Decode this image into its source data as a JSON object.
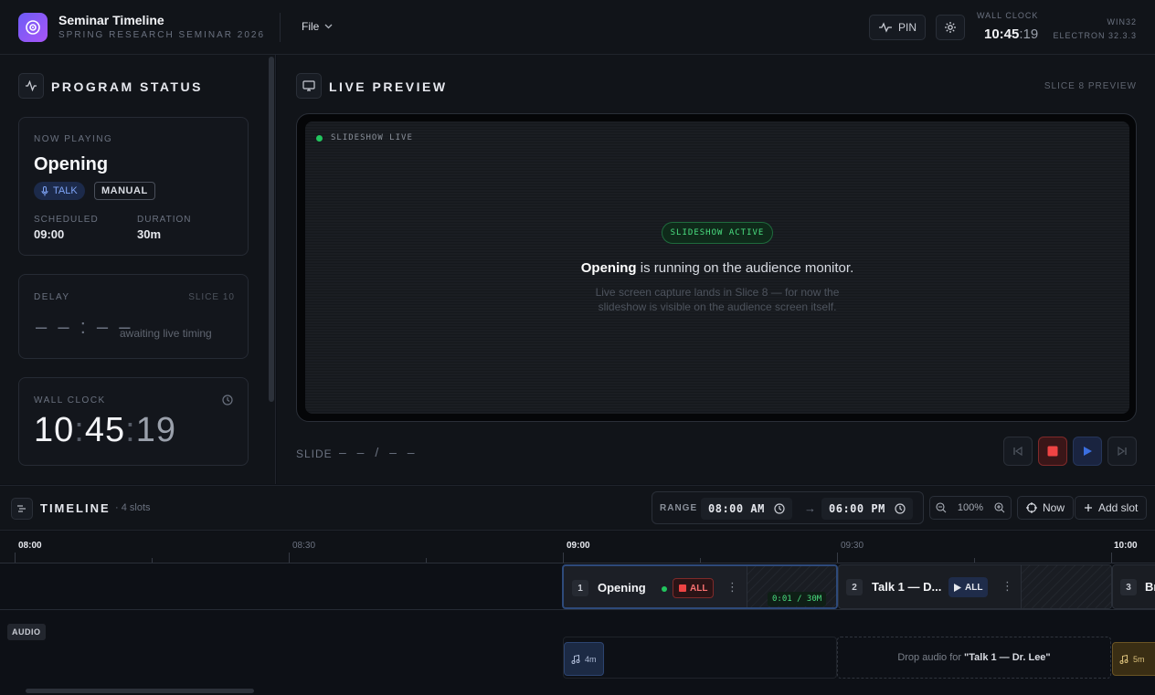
{
  "header": {
    "app_title": "Seminar Timeline",
    "app_subtitle": "SPRING RESEARCH SEMINAR 2026",
    "file_menu": "File",
    "pin_label": "PIN",
    "wall_clock_label": "WALL CLOCK",
    "wall_clock_hm": "10:45",
    "wall_clock_sec": ":19",
    "platform": "WIN32",
    "electron": "ELECTRON 32.3.3"
  },
  "program_status": {
    "title": "PROGRAM STATUS",
    "now_playing": {
      "label": "NOW PLAYING",
      "title": "Opening",
      "type_tag": "TALK",
      "mode_tag": "MANUAL",
      "scheduled_label": "SCHEDULED",
      "scheduled_value": "09:00",
      "duration_label": "DURATION",
      "duration_value": "30m"
    },
    "delay": {
      "label": "DELAY",
      "slice": "SLICE 10",
      "value": "– – : – –",
      "note": "awaiting live timing"
    },
    "wall_clock": {
      "label": "WALL CLOCK",
      "hh": "10",
      "mm": "45",
      "ss": "19",
      "sep": ":"
    }
  },
  "live_preview": {
    "title": "LIVE PREVIEW",
    "slice_note": "SLICE 8 PREVIEW",
    "live_label": "SLIDESHOW LIVE",
    "active_badge": "SLIDESHOW ACTIVE",
    "main_bold": "Opening",
    "main_rest": " is running on the audience monitor.",
    "note": "Live screen capture lands in Slice 8 — for now the slideshow is visible on the audience screen itself.",
    "slide_label": "SLIDE",
    "slide_value": "– –  /  – –"
  },
  "timeline": {
    "title": "TIMELINE",
    "count": "· 4 slots",
    "range_label": "RANGE",
    "range_start": "08:00 AM",
    "range_end": "06:00 PM",
    "range_arrow": "→",
    "zoom": "100%",
    "now_label": "Now",
    "add_slot_label": "Add slot",
    "ruler": {
      "hours": [
        "08:00",
        "09:00",
        "10:00"
      ],
      "halves": [
        "08:30",
        "09:30"
      ]
    },
    "slots": [
      {
        "num": "1",
        "name": "Opening",
        "action": "ALL",
        "progress": "0:01 / 30M"
      },
      {
        "num": "2",
        "name": "Talk 1 — D...",
        "action": "ALL"
      },
      {
        "num": "3",
        "name": "Br"
      }
    ],
    "audio": {
      "label": "AUDIO",
      "clip1": "4m",
      "drop_prefix": "Drop audio for",
      "drop_target": "\"Talk 1 — Dr. Lee\"",
      "clip3": "5m"
    }
  },
  "colors": {
    "accent": "#6d5cf6",
    "live_green": "#22c55e",
    "stop_red": "#ef4444",
    "talk_blue": "#7ea3f5",
    "audio_clip_gold": "#c9a24a"
  }
}
